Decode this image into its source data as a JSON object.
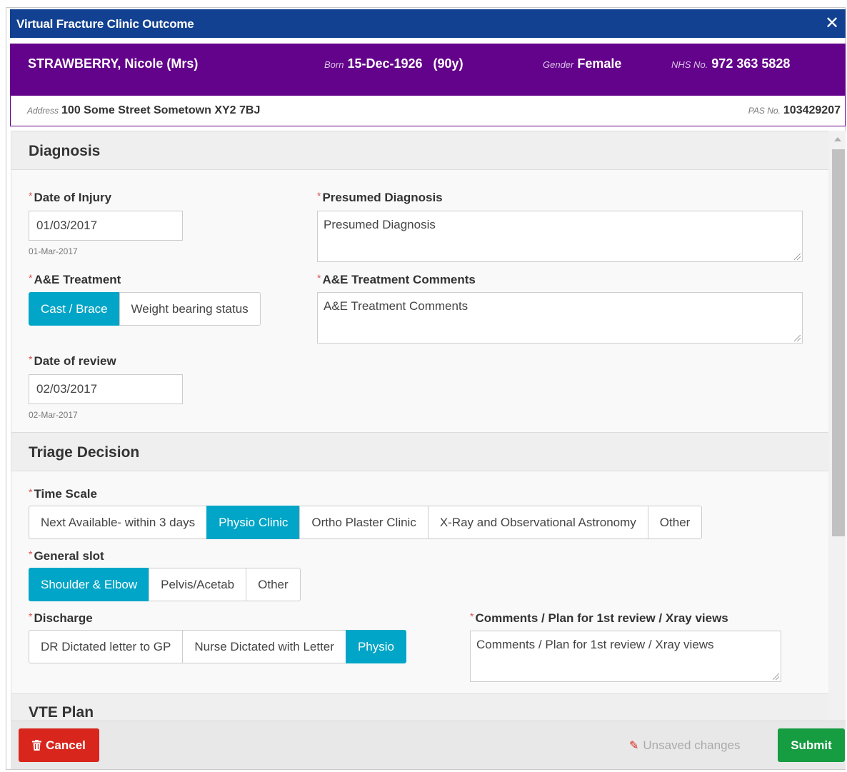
{
  "modal": {
    "title": "Virtual Fracture Clinic Outcome",
    "close_icon": "✕"
  },
  "patient": {
    "name": "STRAWBERRY, Nicole (Mrs)",
    "born_label": "Born",
    "born_value": "15-Dec-1926   (90y)",
    "gender_label": "Gender",
    "gender_value": "Female",
    "nhs_label": "NHS No.",
    "nhs_value": "972 363 5828",
    "address_label": "Address",
    "address_value": "100 Some Street Sometown XY2 7BJ",
    "pas_label": "PAS No.",
    "pas_value": "103429207"
  },
  "diagnosis": {
    "heading": "Diagnosis",
    "date_of_injury_label": "Date of Injury",
    "date_of_injury_value": "01/03/2017",
    "date_of_injury_hint": "01-Mar-2017",
    "presumed_diagnosis_label": "Presumed Diagnosis",
    "presumed_diagnosis_placeholder": "Presumed Diagnosis",
    "ae_treatment_label": "A&E Treatment",
    "ae_treatment_options": [
      "Cast / Brace",
      "Weight bearing status"
    ],
    "ae_treatment_selected": "Cast / Brace",
    "ae_comments_label": "A&E Treatment Comments",
    "ae_comments_placeholder": "A&E Treatment Comments",
    "date_of_review_label": "Date of review",
    "date_of_review_value": "02/03/2017",
    "date_of_review_hint": "02-Mar-2017"
  },
  "triage": {
    "heading": "Triage Decision",
    "time_scale_label": "Time Scale",
    "time_scale_options": [
      "Next Available- within 3 days",
      "Physio Clinic",
      "Ortho Plaster Clinic",
      "X-Ray and Observational Astronomy",
      "Other"
    ],
    "time_scale_selected": "Physio Clinic",
    "general_slot_label": "General slot",
    "general_slot_options": [
      "Shoulder & Elbow",
      "Pelvis/Acetab",
      "Other"
    ],
    "general_slot_selected": "Shoulder & Elbow",
    "discharge_label": "Discharge",
    "discharge_options": [
      "DR Dictated letter to GP",
      "Nurse Dictated with Letter",
      "Physio"
    ],
    "discharge_selected": "Physio",
    "comments_label": "Comments / Plan for 1st review / Xray views",
    "comments_placeholder": "Comments / Plan for 1st review / Xray views"
  },
  "vte": {
    "heading": "VTE Plan"
  },
  "footer": {
    "cancel_label": "Cancel",
    "unsaved_label": "Unsaved changes",
    "submit_label": "Submit"
  },
  "colors": {
    "title_bar": "#124191",
    "patient_banner": "#63028a",
    "active_button": "#00a5c7",
    "cancel": "#d9261c",
    "submit": "#169c41"
  }
}
